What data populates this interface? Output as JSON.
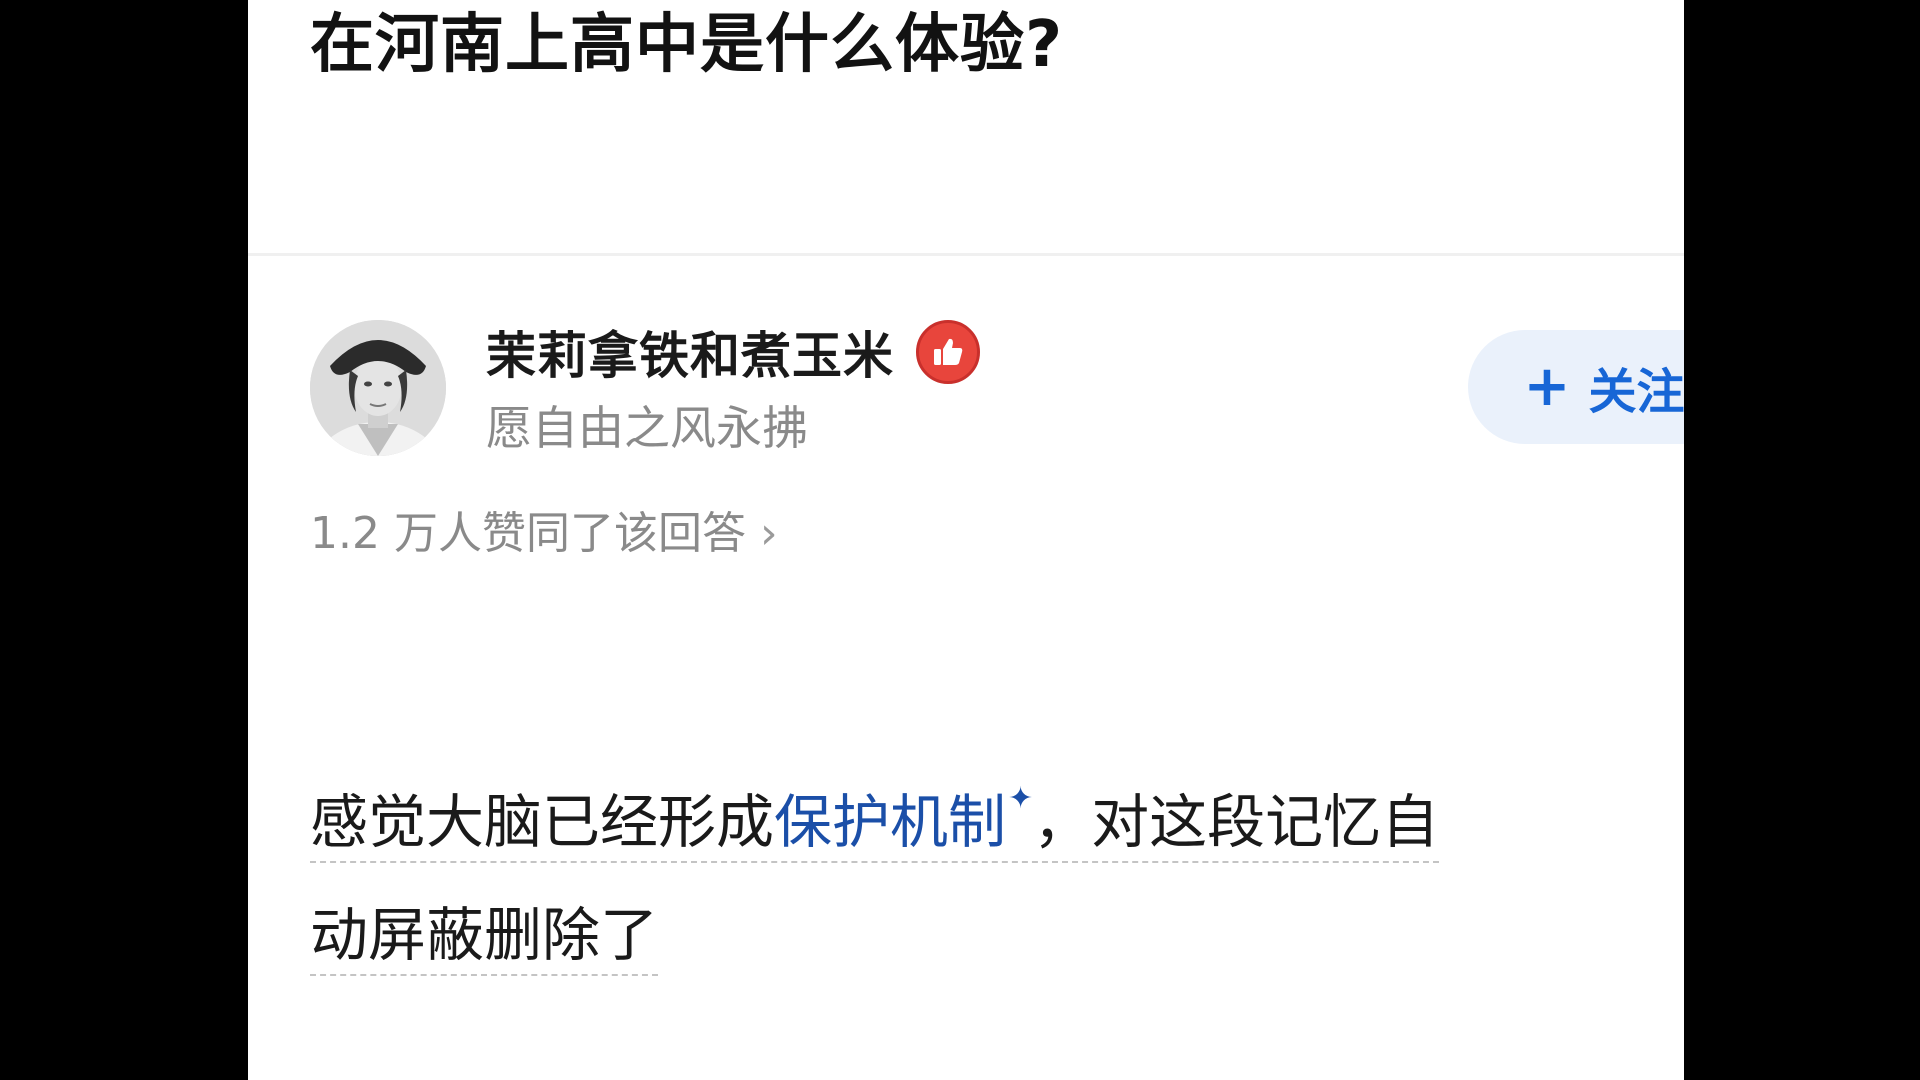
{
  "question": {
    "title": "在河南上高中是什么体验?"
  },
  "author": {
    "name": "茉莉拿铁和煮玉米",
    "bio": "愿自由之风永拂",
    "badge_icon": "thumbs-up-icon",
    "badge_color": "#e8453c"
  },
  "follow": {
    "plus": "+",
    "label": "关注",
    "color": "#1766d6",
    "background": "#eaf1fb"
  },
  "share": {
    "icon": "share-icon"
  },
  "upvotes": {
    "text": "1.2 万人赞同了该回答",
    "chevron": "›"
  },
  "answer": {
    "line1_prefix": "感觉大脑已经形成",
    "link_text": "保护机制",
    "link_mark": "✦",
    "line1_suffix": "，对这段记忆自",
    "line2": "动屏蔽删除了",
    "link_color": "#1b4fa8"
  }
}
